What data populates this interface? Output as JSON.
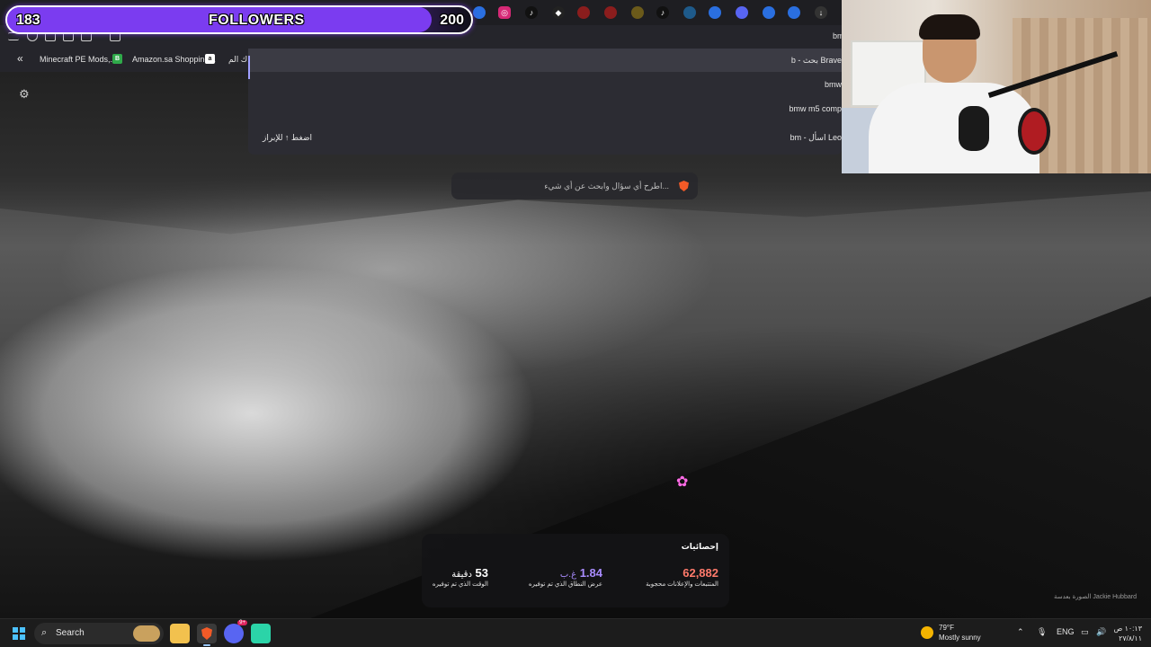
{
  "overlay": {
    "followers_current": "183",
    "followers_label": "FOLLOWERS",
    "followers_goal": "200",
    "progress_fraction": 0.915
  },
  "browser": {
    "bookmarks": [
      "Minecraft PE Mods,...",
      "Amazon.sa Shopping...",
      "ك الم..."
    ],
    "address_partial": "bm",
    "suggestions": [
      {
        "text": "b - بحث Brave",
        "hint": ""
      },
      {
        "text": "bmw",
        "hint": ""
      },
      {
        "text": "bmw m5 comp",
        "hint": ""
      },
      {
        "text": "bm - اسأل Leo",
        "hint": "اضغط ↑ للإبراز"
      }
    ]
  },
  "newtab": {
    "search_placeholder": "اطرح أي سؤال وابحث عن أي شيء...",
    "stats_title": "إحصائيات",
    "stats": [
      {
        "value": "62,882",
        "unit": "",
        "label": "المتتبعات والإعلانات محجوبة",
        "color": "#ff7a6b"
      },
      {
        "value": "1.84",
        "unit": "غ.ب",
        "label": "عرض النطاق الذي تم توفيره",
        "color": "#a98cff"
      },
      {
        "value": "53",
        "unit": "دقيقة",
        "label": "الوقت الذي تم توفيره",
        "color": "#ffffff"
      }
    ],
    "photo_credit": "الصورة بعدسة Jackie Hubbard"
  },
  "taskbar": {
    "search_label": "Search",
    "weather_temp": "79°F",
    "weather_desc": "Mostly sunny",
    "lang": "ENG",
    "time": "١٠:١٣ ص",
    "date": "٢٧/٨/١١",
    "discord_badge": "9+"
  },
  "icons": [
    "windows-logo-icon",
    "search-icon",
    "file-explorer-icon",
    "brave-icon",
    "discord-icon",
    "app-icon",
    "gear-icon",
    "brave-lion-icon"
  ]
}
